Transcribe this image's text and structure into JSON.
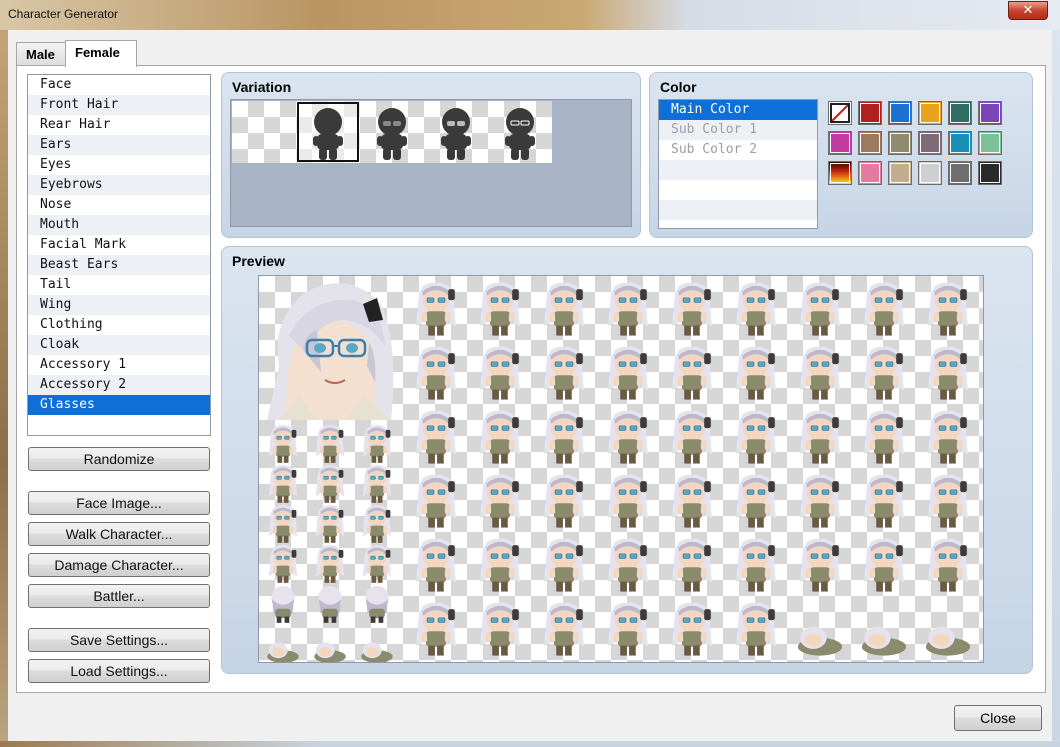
{
  "window": {
    "title": "Character Generator",
    "close_glyph": "✕"
  },
  "tabs": [
    {
      "label": "Male",
      "active": false
    },
    {
      "label": "Female",
      "active": true
    }
  ],
  "parts": {
    "items": [
      "Face",
      "Front Hair",
      "Rear Hair",
      "Ears",
      "Eyes",
      "Eyebrows",
      "Nose",
      "Mouth",
      "Facial Mark",
      "Beast Ears",
      "Tail",
      "Wing",
      "Clothing",
      "Cloak",
      "Accessory 1",
      "Accessory 2",
      "Glasses"
    ],
    "selected": "Glasses"
  },
  "buttons": {
    "randomize": "Randomize",
    "face_image": "Face Image...",
    "walk_character": "Walk Character...",
    "damage_character": "Damage Character...",
    "battler": "Battler...",
    "save_settings": "Save Settings...",
    "load_settings": "Load Settings...",
    "close": "Close"
  },
  "variation": {
    "label": "Variation",
    "count": 5,
    "selected_index": 1,
    "glasses_styles": [
      "none",
      "round-clear",
      "round-tinted",
      "round-light",
      "dark-frames"
    ]
  },
  "color": {
    "label": "Color",
    "channels": [
      "Main Color",
      "Sub Color 1",
      "Sub Color 2"
    ],
    "selected": "Main Color",
    "swatches": [
      "none",
      "#b0201f",
      "#1f6fd0",
      "#e7a41c",
      "#2f6d63",
      "#7a45b8",
      "#c03aa0",
      "#9b7a5e",
      "#8f8a70",
      "#7f6b78",
      "#1a8fb8",
      "#7cc19a",
      "gradient-fire",
      "#e57aa0",
      "#c2ad8c",
      "#cfcfcf",
      "#6e6e6e",
      "#2a2a2a"
    ]
  },
  "preview": {
    "label": "Preview"
  }
}
